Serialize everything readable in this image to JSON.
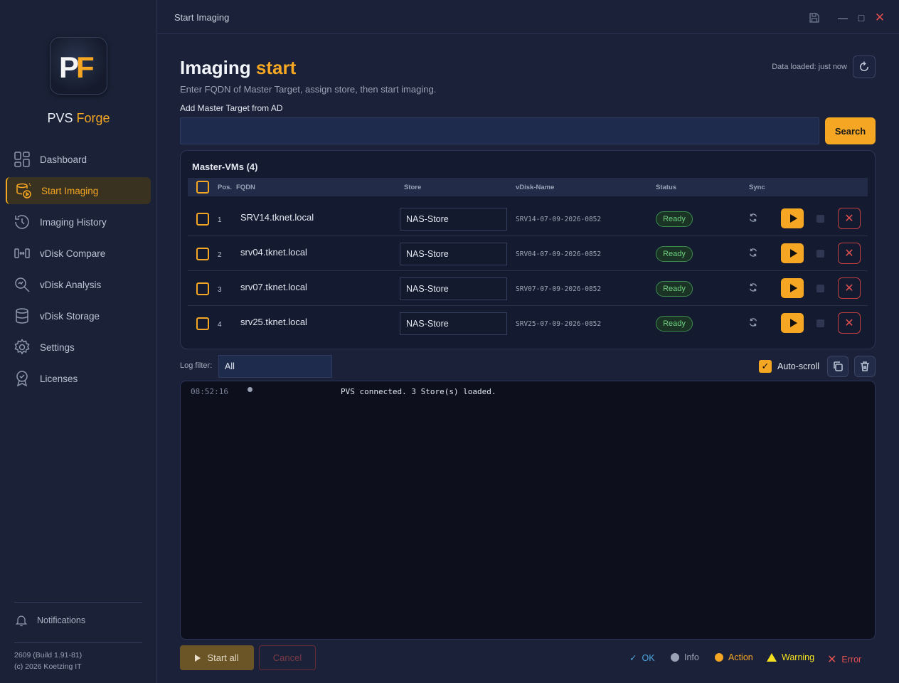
{
  "app": {
    "brand_prefix": "PVS",
    "brand_suffix": "Forge",
    "window_title": "Start Imaging",
    "version_line1": "2609 (Build 1.91-81)",
    "version_line2": "(c) 2026 Koetzing IT"
  },
  "sidebar": {
    "items": [
      {
        "label": "Dashboard",
        "icon": "dashboard-icon"
      },
      {
        "label": "Start Imaging",
        "icon": "start-imaging-icon",
        "active": true
      },
      {
        "label": "Imaging History",
        "icon": "history-icon"
      },
      {
        "label": "vDisk Compare",
        "icon": "compare-icon"
      },
      {
        "label": "vDisk Analysis",
        "icon": "analysis-icon"
      },
      {
        "label": "vDisk Storage",
        "icon": "storage-icon"
      },
      {
        "label": "Settings",
        "icon": "gear-icon"
      },
      {
        "label": "Licenses",
        "icon": "license-icon"
      }
    ],
    "notifications_label": "Notifications"
  },
  "header": {
    "title_main": "Imaging",
    "title_accent": "start",
    "subtitle": "Enter FQDN of Master Target, assign store, then start imaging.",
    "data_loaded": "Data loaded: just now"
  },
  "search": {
    "label": "Add Master Target from AD",
    "value": "",
    "button_label": "Search"
  },
  "table": {
    "title": "Master-VMs (4)",
    "columns": {
      "pos": "Pos.",
      "fqdn": "FQDN",
      "store": "Store",
      "vdisk": "vDisk-Name",
      "status": "Status",
      "sync": "Sync"
    },
    "rows": [
      {
        "pos": "1",
        "fqdn": "SRV14.tknet.local",
        "store": "NAS-Store",
        "vdisk": "SRV14-07-09-2026-0852",
        "status": "Ready"
      },
      {
        "pos": "2",
        "fqdn": "srv04.tknet.local",
        "store": "NAS-Store",
        "vdisk": "SRV04-07-09-2026-0852",
        "status": "Ready"
      },
      {
        "pos": "3",
        "fqdn": "srv07.tknet.local",
        "store": "NAS-Store",
        "vdisk": "SRV07-07-09-2026-0852",
        "status": "Ready"
      },
      {
        "pos": "4",
        "fqdn": "srv25.tknet.local",
        "store": "NAS-Store",
        "vdisk": "SRV25-07-09-2026-0852",
        "status": "Ready"
      }
    ]
  },
  "log": {
    "filter_label": "Log filter:",
    "filter_value": "All",
    "autoscroll_label": "Auto-scroll",
    "autoscroll_checked": true,
    "entries": [
      {
        "time": "08:52:16",
        "level": "info",
        "message": "PVS connected. 3 Store(s) loaded."
      }
    ]
  },
  "footer": {
    "start_all": "Start all",
    "cancel": "Cancel",
    "legend": [
      {
        "label": "OK",
        "color": "#4da6e0",
        "symbol": "check"
      },
      {
        "label": "Info",
        "color": "#9aa3b6",
        "symbol": "dot"
      },
      {
        "label": "Action",
        "color": "#f5a623",
        "symbol": "dot"
      },
      {
        "label": "Warning",
        "color": "#f5e020",
        "symbol": "triangle"
      },
      {
        "label": "Error",
        "color": "#e05050",
        "symbol": "cross"
      }
    ]
  },
  "colors": {
    "accent": "#f5a623",
    "ready": "#6fd07f",
    "error": "#e05050"
  }
}
